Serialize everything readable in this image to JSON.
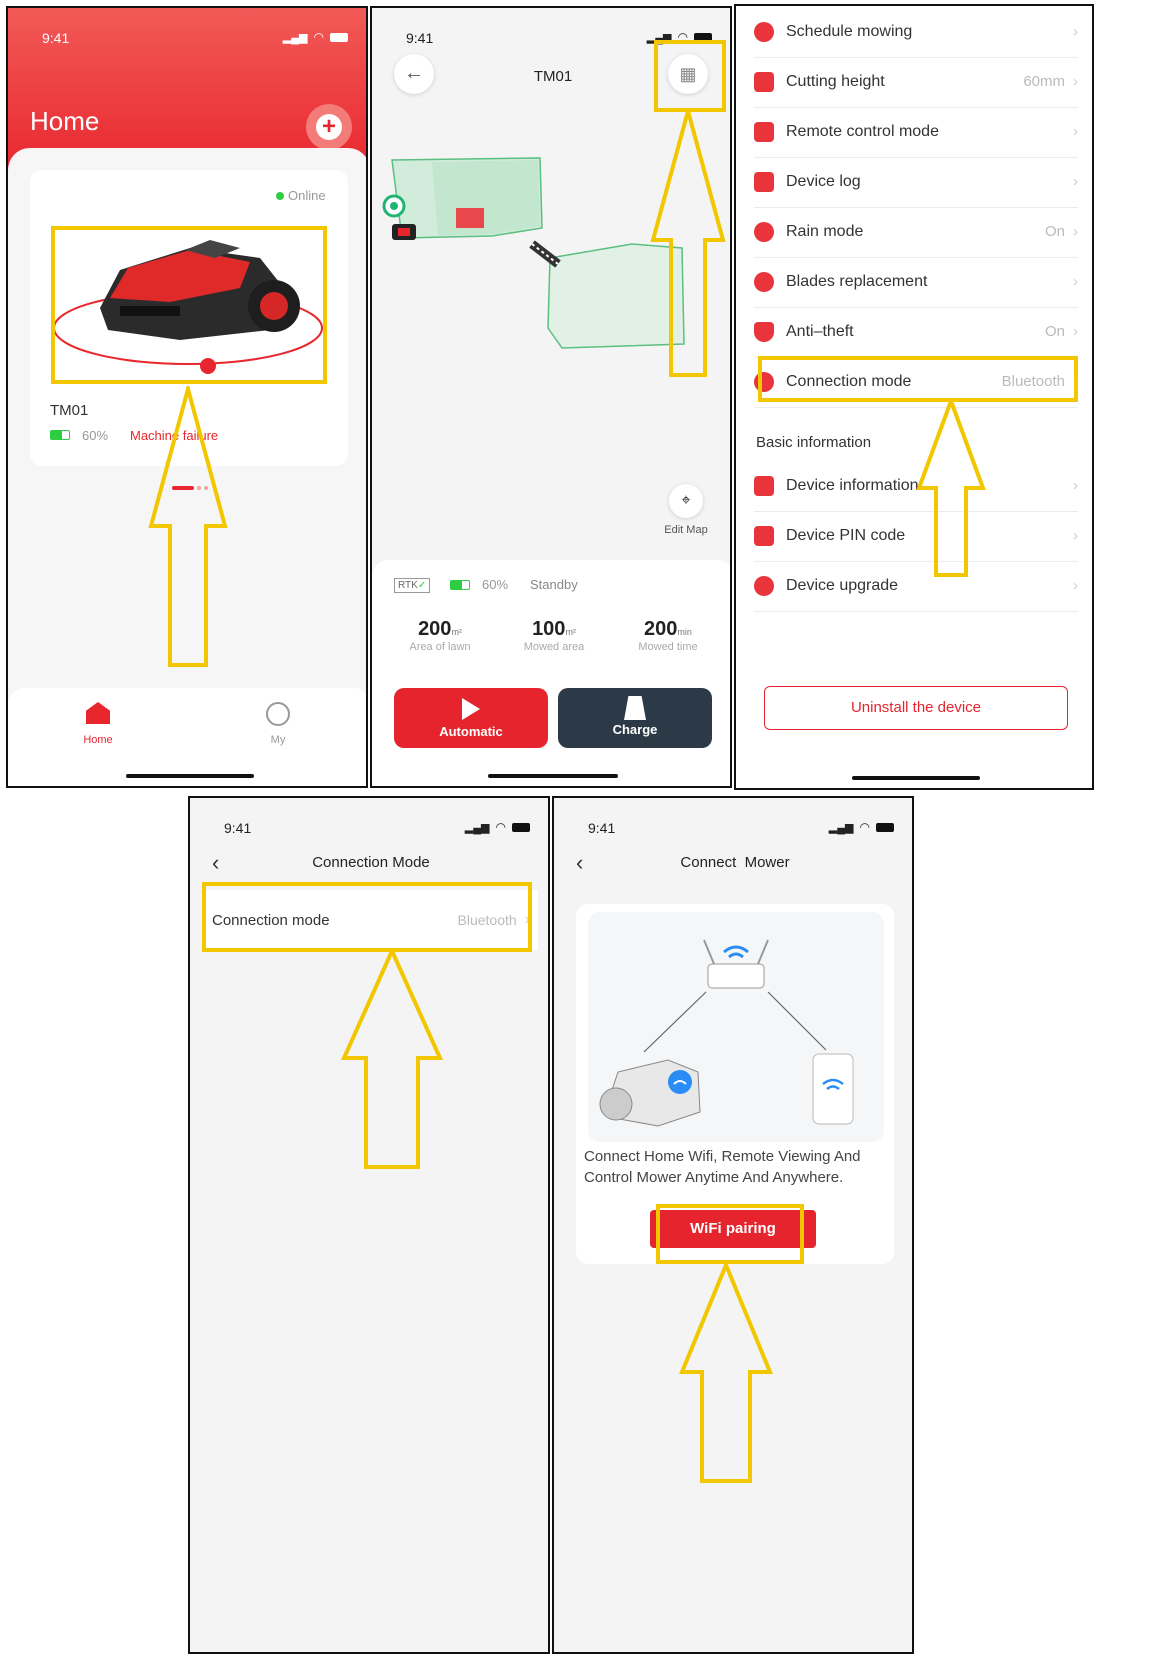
{
  "p1": {
    "time": "9:41",
    "title": "Home",
    "online": "Online",
    "device": "TM01",
    "battery": "60%",
    "status": "Machine failure",
    "nav": [
      "Home",
      "My"
    ]
  },
  "p2": {
    "time": "9:41",
    "title": "TM01",
    "edit_map": "Edit Map",
    "rtk": "RTK",
    "battery": "60%",
    "standby": "Standby",
    "stats": [
      {
        "value": "200",
        "unit": "m²",
        "label": "Area of lawn"
      },
      {
        "value": "100",
        "unit": "m²",
        "label": "Mowed area"
      },
      {
        "value": "200",
        "unit": "min",
        "label": "Mowed time"
      }
    ],
    "automatic": "Automatic",
    "charge": "Charge"
  },
  "p3": {
    "items": [
      {
        "label": "Schedule mowing",
        "value": ""
      },
      {
        "label": "Cutting height",
        "value": "60mm"
      },
      {
        "label": "Remote control mode",
        "value": ""
      },
      {
        "label": "Device log",
        "value": ""
      },
      {
        "label": "Rain mode",
        "value": "On"
      },
      {
        "label": "Blades replacement",
        "value": ""
      },
      {
        "label": "Anti–theft",
        "value": "On"
      },
      {
        "label": "Connection mode",
        "value": "Bluetooth"
      }
    ],
    "section": "Basic information",
    "basic": [
      {
        "label": "Device information"
      },
      {
        "label": "Device PIN code"
      },
      {
        "label": "Device upgrade"
      }
    ],
    "uninstall": "Uninstall the device"
  },
  "p4": {
    "time": "9:41",
    "title": "Connection Mode",
    "row_label": "Connection mode",
    "row_value": "Bluetooth"
  },
  "p5": {
    "time": "9:41",
    "title": "Connect  Mower",
    "desc1": "Connect Home Wifi, Remote Viewing And",
    "desc2": "Control Mower Anytime And Anywhere.",
    "button": "WiFi pairing"
  },
  "colors": {
    "accent": "#e5242d",
    "highlight": "#f2c700",
    "dark": "#2c3a47"
  }
}
